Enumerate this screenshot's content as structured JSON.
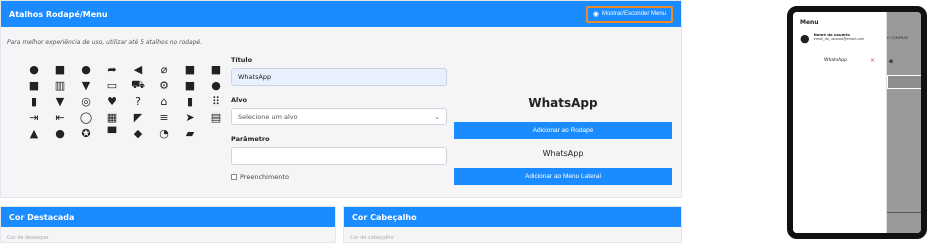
{
  "shortcuts_card": {
    "title": "Atalhos Rodapé/Menu",
    "toggle_label": "Mostrar/Esconder Menu",
    "hint": "Para melhor experiência de uso, utilizar até 5 atalhos no rodapé.",
    "icons": [
      {
        "name": "dot-circle-icon",
        "glyph": "●"
      },
      {
        "name": "briefcase-icon",
        "glyph": "■"
      },
      {
        "name": "info-circle-icon",
        "glyph": "●"
      },
      {
        "name": "share-icon",
        "glyph": "➦"
      },
      {
        "name": "reply-icon",
        "glyph": "◀"
      },
      {
        "name": "paperclip-icon",
        "glyph": "⌀"
      },
      {
        "name": "shopping-bag-icon",
        "glyph": "■"
      },
      {
        "name": "bag-check-icon",
        "glyph": "■"
      },
      {
        "name": "lock-bag-icon",
        "glyph": "■"
      },
      {
        "name": "barcode-icon",
        "glyph": "▥"
      },
      {
        "name": "basket-icon",
        "glyph": "▼"
      },
      {
        "name": "card-icon",
        "glyph": "▭"
      },
      {
        "name": "cart-icon",
        "glyph": "⛟"
      },
      {
        "name": "settings-gear-icon",
        "glyph": "⚙"
      },
      {
        "name": "square-icon",
        "glyph": "■"
      },
      {
        "name": "compass-icon",
        "glyph": "●"
      },
      {
        "name": "file-icon",
        "glyph": "▮"
      },
      {
        "name": "basket-full-icon",
        "glyph": "▼"
      },
      {
        "name": "fingerprint-icon",
        "glyph": "◎"
      },
      {
        "name": "heart-icon",
        "glyph": "♥"
      },
      {
        "name": "question-icon",
        "glyph": "?"
      },
      {
        "name": "home-icon",
        "glyph": "⌂"
      },
      {
        "name": "mobile-icon",
        "glyph": "▮"
      },
      {
        "name": "grid-icon",
        "glyph": "⠿"
      },
      {
        "name": "sign-in-icon",
        "glyph": "⇥"
      },
      {
        "name": "sign-out-icon",
        "glyph": "⇤"
      },
      {
        "name": "whatsapp-icon",
        "glyph": "◯"
      },
      {
        "name": "map-icon",
        "glyph": "▦"
      },
      {
        "name": "megaphone-icon",
        "glyph": "◤"
      },
      {
        "name": "menu-bars-icon",
        "glyph": "≡"
      },
      {
        "name": "paper-plane-icon",
        "glyph": "➤"
      },
      {
        "name": "newspaper-icon",
        "glyph": "▤"
      },
      {
        "name": "user-icon",
        "glyph": "▲"
      },
      {
        "name": "user-circle-icon",
        "glyph": "●"
      },
      {
        "name": "award-icon",
        "glyph": "✪"
      },
      {
        "name": "store-icon",
        "glyph": "▀"
      },
      {
        "name": "ticket-icon",
        "glyph": "◆"
      },
      {
        "name": "clock-icon",
        "glyph": "◔"
      },
      {
        "name": "wallet-icon",
        "glyph": "▰"
      }
    ],
    "form": {
      "title_label": "Título",
      "title_value": "WhatsApp",
      "target_label": "Alvo",
      "target_placeholder": "Selecione um alvo",
      "param_label": "Parâmetro",
      "param_value": "",
      "fill_label": "Preenchimento"
    },
    "preview": {
      "title": "WhatsApp",
      "add_footer_label": "Adicionar ao Rodapé",
      "text": "WhatsApp",
      "add_menu_label": "Adicionar ao Menu Lateral"
    }
  },
  "highlight_card": {
    "title": "Cor Destacada",
    "hint": "Cor de destaque"
  },
  "header_card": {
    "title": "Cor Cabeçalho",
    "hint": "Cor de cabeçalho"
  },
  "phone": {
    "menu_title": "Menu",
    "user_name": "Nome do usuário",
    "user_email": "email_do_usuario@email.com",
    "menu_item": "WhatsApp",
    "bg_text1": "E COMPRAS",
    "bg_text2": "e"
  },
  "colors": {
    "primary": "#1a8cff",
    "accent_border": "#f08a24",
    "remove": "#e33"
  }
}
